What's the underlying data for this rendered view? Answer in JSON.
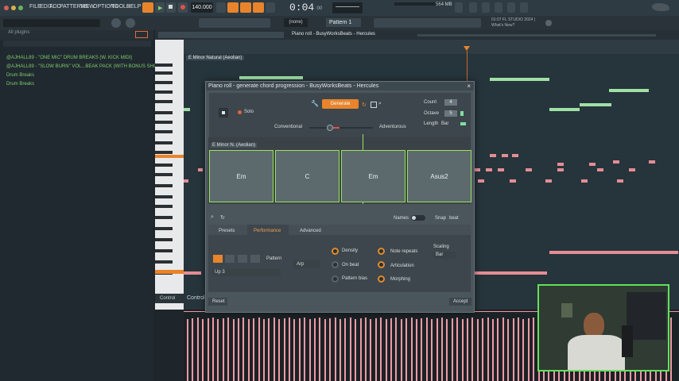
{
  "menu": [
    "FILE",
    "EDIT",
    "ADD",
    "PATTERNS",
    "VIEW",
    "OPTIONS",
    "TOOLS",
    "HELP"
  ],
  "transport": {
    "tempo": "140.000",
    "time": "0:04",
    "time_ms": ":00",
    "pattern": "Pattern 1",
    "snap_none": "(none)",
    "memory": "564 MB"
  },
  "hint": {
    "line1": "01:07 FL STUDIO 2024 |",
    "line2": "What's New?"
  },
  "browser": {
    "label": "All plugins",
    "items": [
      "@AJHALL89 - \"ONE MIC\" DRUM BREAKS (W. KICK MIDI)",
      "@AJHALL89 - \"SLOW BURN\" VOL...BEAK PACK (WITH BONUS SHOTS)",
      "Drum Breaks",
      "Drum Breaks"
    ]
  },
  "pianoroll": {
    "title": "Piano roll - BusyWorksBeats - Hercules",
    "scale_label": "E Minor Natural (Aeolian)",
    "control_label": "Control"
  },
  "dialog": {
    "title": "Piano roll - generate chord progression - BusyWorksBeats - Hercules",
    "generate": "Generate",
    "solo": "Solo",
    "count_label": "Count",
    "count_value": "4",
    "octave_label": "Octave",
    "octave_value": "5",
    "length_label": "Length",
    "length_value": "Bar",
    "conventional": "Conventional",
    "adventurous": "Adventurous",
    "scale": "E Minor N. (Aeolian)",
    "chords": [
      "Em",
      "C",
      "Em",
      "Asus2"
    ],
    "names_label": "Names",
    "snap_label": "Snap",
    "snap_value": "beat",
    "tabs": [
      "Presets",
      "Performance",
      "Advanced"
    ],
    "pattern_label": "Pattern",
    "pattern_value": "Up 3",
    "arp": "Arp",
    "knobs": [
      "Density",
      "On beat",
      "Pattern bias",
      "Note repeats",
      "Articulation",
      "Morphing"
    ],
    "scaling_label": "Scaling",
    "scaling_value": "Bar",
    "reset": "Reset",
    "accept": "Accept"
  },
  "colors": {
    "accent": "#e8842c",
    "chord_border": "#9be05f",
    "note": "#e48d95",
    "webcam_border": "#62e25a"
  }
}
